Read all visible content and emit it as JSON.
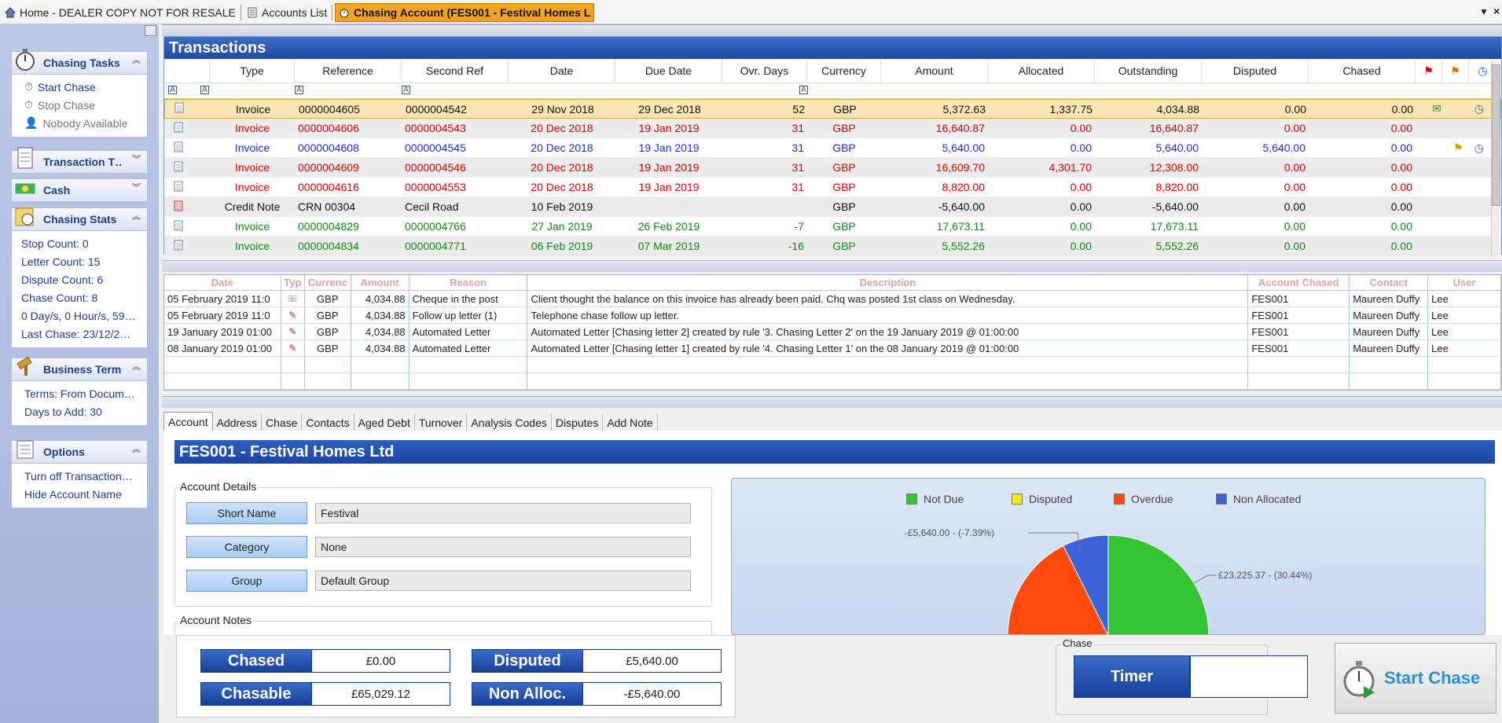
{
  "tabs": [
    {
      "label": "Home - DEALER COPY NOT FOR RESALE"
    },
    {
      "label": "Accounts List"
    },
    {
      "label": "Chasing Account (FES001 - Festival Homes L"
    }
  ],
  "sidebar": {
    "chasing_tasks": {
      "title": "Chasing Tasks",
      "items": [
        {
          "label": "Start Chase"
        },
        {
          "label": "Stop Chase"
        },
        {
          "label": "Nobody Available"
        }
      ]
    },
    "transaction_t": {
      "title": "Transaction T…"
    },
    "cash": {
      "title": "Cash"
    },
    "chasing_stats": {
      "title": "Chasing Stats",
      "items": [
        {
          "label": "Stop Count: 0"
        },
        {
          "label": "Letter Count: 15"
        },
        {
          "label": "Dispute Count: 6"
        },
        {
          "label": "Chase Count: 8"
        },
        {
          "label": "0 Day/s, 0 Hour/s, 59…"
        },
        {
          "label": "Last Chase: 23/12/2…"
        }
      ]
    },
    "business_terms": {
      "title": "Business Terms",
      "items": [
        {
          "label": "Terms: From Docum…"
        },
        {
          "label": "Days to Add: 30"
        }
      ]
    },
    "options": {
      "title": "Options",
      "items": [
        {
          "label": "Turn off Transaction…"
        },
        {
          "label": "Hide Account Name"
        }
      ]
    }
  },
  "transactions": {
    "title": "Transactions",
    "columns": [
      "Type",
      "Reference",
      "Second Ref",
      "Date",
      "Due Date",
      "Ovr. Days",
      "Currency",
      "Amount",
      "Allocated",
      "Outstanding",
      "Disputed",
      "Chased"
    ],
    "rows": [
      {
        "type": "Invoice",
        "ref": "0000004605",
        "ref2": "0000004542",
        "date": "29 Nov 2018",
        "due": "29 Dec 2018",
        "ovr": "52",
        "cur": "GBP",
        "amount": "5,372.63",
        "alloc": "1,337.75",
        "outst": "4,034.88",
        "disp": "0.00",
        "chased": "0.00",
        "color": "black"
      },
      {
        "type": "Invoice",
        "ref": "0000004606",
        "ref2": "0000004543",
        "date": "20 Dec 2018",
        "due": "19 Jan 2019",
        "ovr": "31",
        "cur": "GBP",
        "amount": "16,640.87",
        "alloc": "0.00",
        "outst": "16,640.87",
        "disp": "0.00",
        "chased": "0.00",
        "color": "red"
      },
      {
        "type": "Invoice",
        "ref": "0000004608",
        "ref2": "0000004545",
        "date": "20 Dec 2018",
        "due": "19 Jan 2019",
        "ovr": "31",
        "cur": "GBP",
        "amount": "5,640.00",
        "alloc": "0.00",
        "outst": "5,640.00",
        "disp": "5,640.00",
        "chased": "0.00",
        "color": "blue"
      },
      {
        "type": "Invoice",
        "ref": "0000004609",
        "ref2": "0000004546",
        "date": "20 Dec 2018",
        "due": "19 Jan 2019",
        "ovr": "31",
        "cur": "GBP",
        "amount": "16,609.70",
        "alloc": "4,301.70",
        "outst": "12,308.00",
        "disp": "0.00",
        "chased": "0.00",
        "color": "red"
      },
      {
        "type": "Invoice",
        "ref": "0000004616",
        "ref2": "0000004553",
        "date": "20 Dec 2018",
        "due": "19 Jan 2019",
        "ovr": "31",
        "cur": "GBP",
        "amount": "8,820.00",
        "alloc": "0.00",
        "outst": "8,820.00",
        "disp": "0.00",
        "chased": "0.00",
        "color": "red"
      },
      {
        "type": "Credit Note",
        "ref": "CRN 00304",
        "ref2": "Cecil Road",
        "date": "10 Feb 2019",
        "due": "",
        "ovr": "",
        "cur": "GBP",
        "amount": "-5,640.00",
        "alloc": "0.00",
        "outst": "-5,640.00",
        "disp": "0.00",
        "chased": "0.00",
        "color": "black"
      },
      {
        "type": "Invoice",
        "ref": "0000004829",
        "ref2": "0000004766",
        "date": "27 Jan 2019",
        "due": "26 Feb 2019",
        "ovr": "-7",
        "cur": "GBP",
        "amount": "17,673.11",
        "alloc": "0.00",
        "outst": "17,673.11",
        "disp": "0.00",
        "chased": "0.00",
        "color": "green"
      },
      {
        "type": "Invoice",
        "ref": "0000004834",
        "ref2": "0000004771",
        "date": "06 Feb 2019",
        "due": "07 Mar 2019",
        "ovr": "-16",
        "cur": "GBP",
        "amount": "5,552.26",
        "alloc": "0.00",
        "outst": "5,552.26",
        "disp": "0.00",
        "chased": "0.00",
        "color": "green"
      }
    ]
  },
  "chase_log": {
    "columns": [
      "Date",
      "Typ",
      "Currenc",
      "Amount",
      "Reason",
      "Description",
      "Account Chased",
      "Contact",
      "User"
    ],
    "rows": [
      {
        "date": "05 February 2019 11:0",
        "cur": "GBP",
        "amount": "4,034.88",
        "reason": "Cheque in the post",
        "desc": "Client thought the balance on this invoice has already been paid.  Chq was posted 1st class on Wednesday.",
        "acct": "FES001",
        "contact": "Maureen Duffy",
        "user": "Lee",
        "icon": "phone-icon"
      },
      {
        "date": "05 February 2019 11:0",
        "cur": "GBP",
        "amount": "4,034.88",
        "reason": "Follow up letter (1)",
        "desc": "Telephone chase follow up letter.",
        "acct": "FES001",
        "contact": "Maureen Duffy",
        "user": "Lee",
        "icon": "letter-icon"
      },
      {
        "date": "19 January 2019 01:00",
        "cur": "GBP",
        "amount": "4,034.88",
        "reason": "Automated Letter",
        "desc": "Automated Letter [Chasing letter 2] created by rule '3. Chasing Letter 2' on the 19 January 2019 @ 01:00:00",
        "acct": "FES001",
        "contact": "Maureen Duffy",
        "user": "Lee",
        "icon": "letter-icon"
      },
      {
        "date": "08 January 2019 01:00",
        "cur": "GBP",
        "amount": "4,034.88",
        "reason": "Automated Letter",
        "desc": "Automated Letter [Chasing letter 1] created by rule '4. Chasing Letter 1' on the 08 January 2019 @ 01:00:00",
        "acct": "FES001",
        "contact": "Maureen Duffy",
        "user": "Lee",
        "icon": "letter-icon"
      }
    ]
  },
  "account_tabs": [
    "Account",
    "Address",
    "Chase",
    "Contacts",
    "Aged Debt",
    "Turnover",
    "Analysis Codes",
    "Disputes",
    "Add Note"
  ],
  "account": {
    "title": "FES001 - Festival Homes Ltd",
    "details_legend": "Account Details",
    "notes_legend": "Account Notes",
    "fields": [
      {
        "label": "Short Name",
        "value": "Festival"
      },
      {
        "label": "Category",
        "value": "None"
      },
      {
        "label": "Group",
        "value": "Default Group"
      }
    ]
  },
  "chart_data": {
    "type": "pie",
    "legend": [
      "Not Due",
      "Disputed",
      "Overdue",
      "Non Allocated"
    ],
    "colors": {
      "Not Due": "#33c333",
      "Disputed": "#f3e81b",
      "Overdue": "#ff4a0f",
      "Non Allocated": "#3c63d8"
    },
    "slices": [
      {
        "name": "Not Due",
        "value": 23225.37,
        "percent": 30.44
      },
      {
        "name": "Overdue",
        "value": 47843.75,
        "percent": 62.71
      },
      {
        "name": "Non Allocated",
        "value": -5640.0,
        "percent": -7.39
      }
    ],
    "labels": [
      "-£5,640.00 - (-7.39%)",
      "£23,225.37 - (30.44%)"
    ]
  },
  "totals": {
    "chased_label": "Chased",
    "chased_value": "£0.00",
    "chasable_label": "Chasable",
    "chasable_value": "£65,029.12",
    "disputed_label": "Disputed",
    "disputed_value": "£5,640.00",
    "nonalloc_label": "Non Alloc.",
    "nonalloc_value": "-£5,640.00"
  },
  "chase_box": {
    "legend": "Chase",
    "timer_label": "Timer",
    "timer_value": "",
    "start_label": "Start Chase"
  }
}
